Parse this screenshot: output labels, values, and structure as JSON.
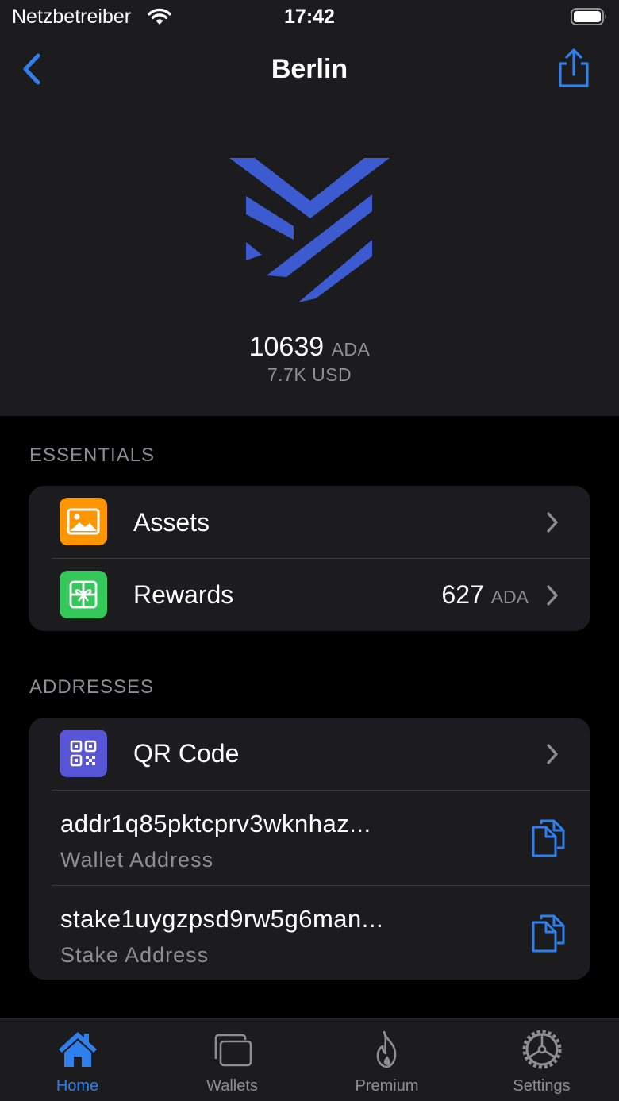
{
  "status_bar": {
    "carrier": "Netzbetreiber",
    "time": "17:42"
  },
  "nav": {
    "title": "Berlin"
  },
  "wallet": {
    "balance": "10639",
    "balance_unit": "ADA",
    "fiat": "7.7K USD"
  },
  "essentials": {
    "title": "ESSENTIALS",
    "items": [
      {
        "label": "Assets",
        "icon": "image-icon",
        "color": "#ff9500"
      },
      {
        "label": "Rewards",
        "icon": "gift-icon",
        "color": "#34c759",
        "value": "627",
        "value_unit": "ADA"
      }
    ]
  },
  "addresses": {
    "title": "ADDRESSES",
    "qr": {
      "label": "QR Code",
      "icon": "qr-code-icon",
      "color": "#5856d6"
    },
    "items": [
      {
        "value": "addr1q85pktcprv3wknhaz...",
        "label": "Wallet Address"
      },
      {
        "value": "stake1uygzpsd9rw5g6man...",
        "label": "Stake Address"
      }
    ]
  },
  "tabs": [
    {
      "label": "Home",
      "icon": "home-icon",
      "active": true
    },
    {
      "label": "Wallets",
      "icon": "wallets-icon",
      "active": false
    },
    {
      "label": "Premium",
      "icon": "flame-icon",
      "active": false
    },
    {
      "label": "Settings",
      "icon": "gear-icon",
      "active": false
    }
  ],
  "colors": {
    "accent": "#2f80ed",
    "logo": "#3d5bd1",
    "background": "#000000",
    "surface": "#1c1c1e"
  }
}
